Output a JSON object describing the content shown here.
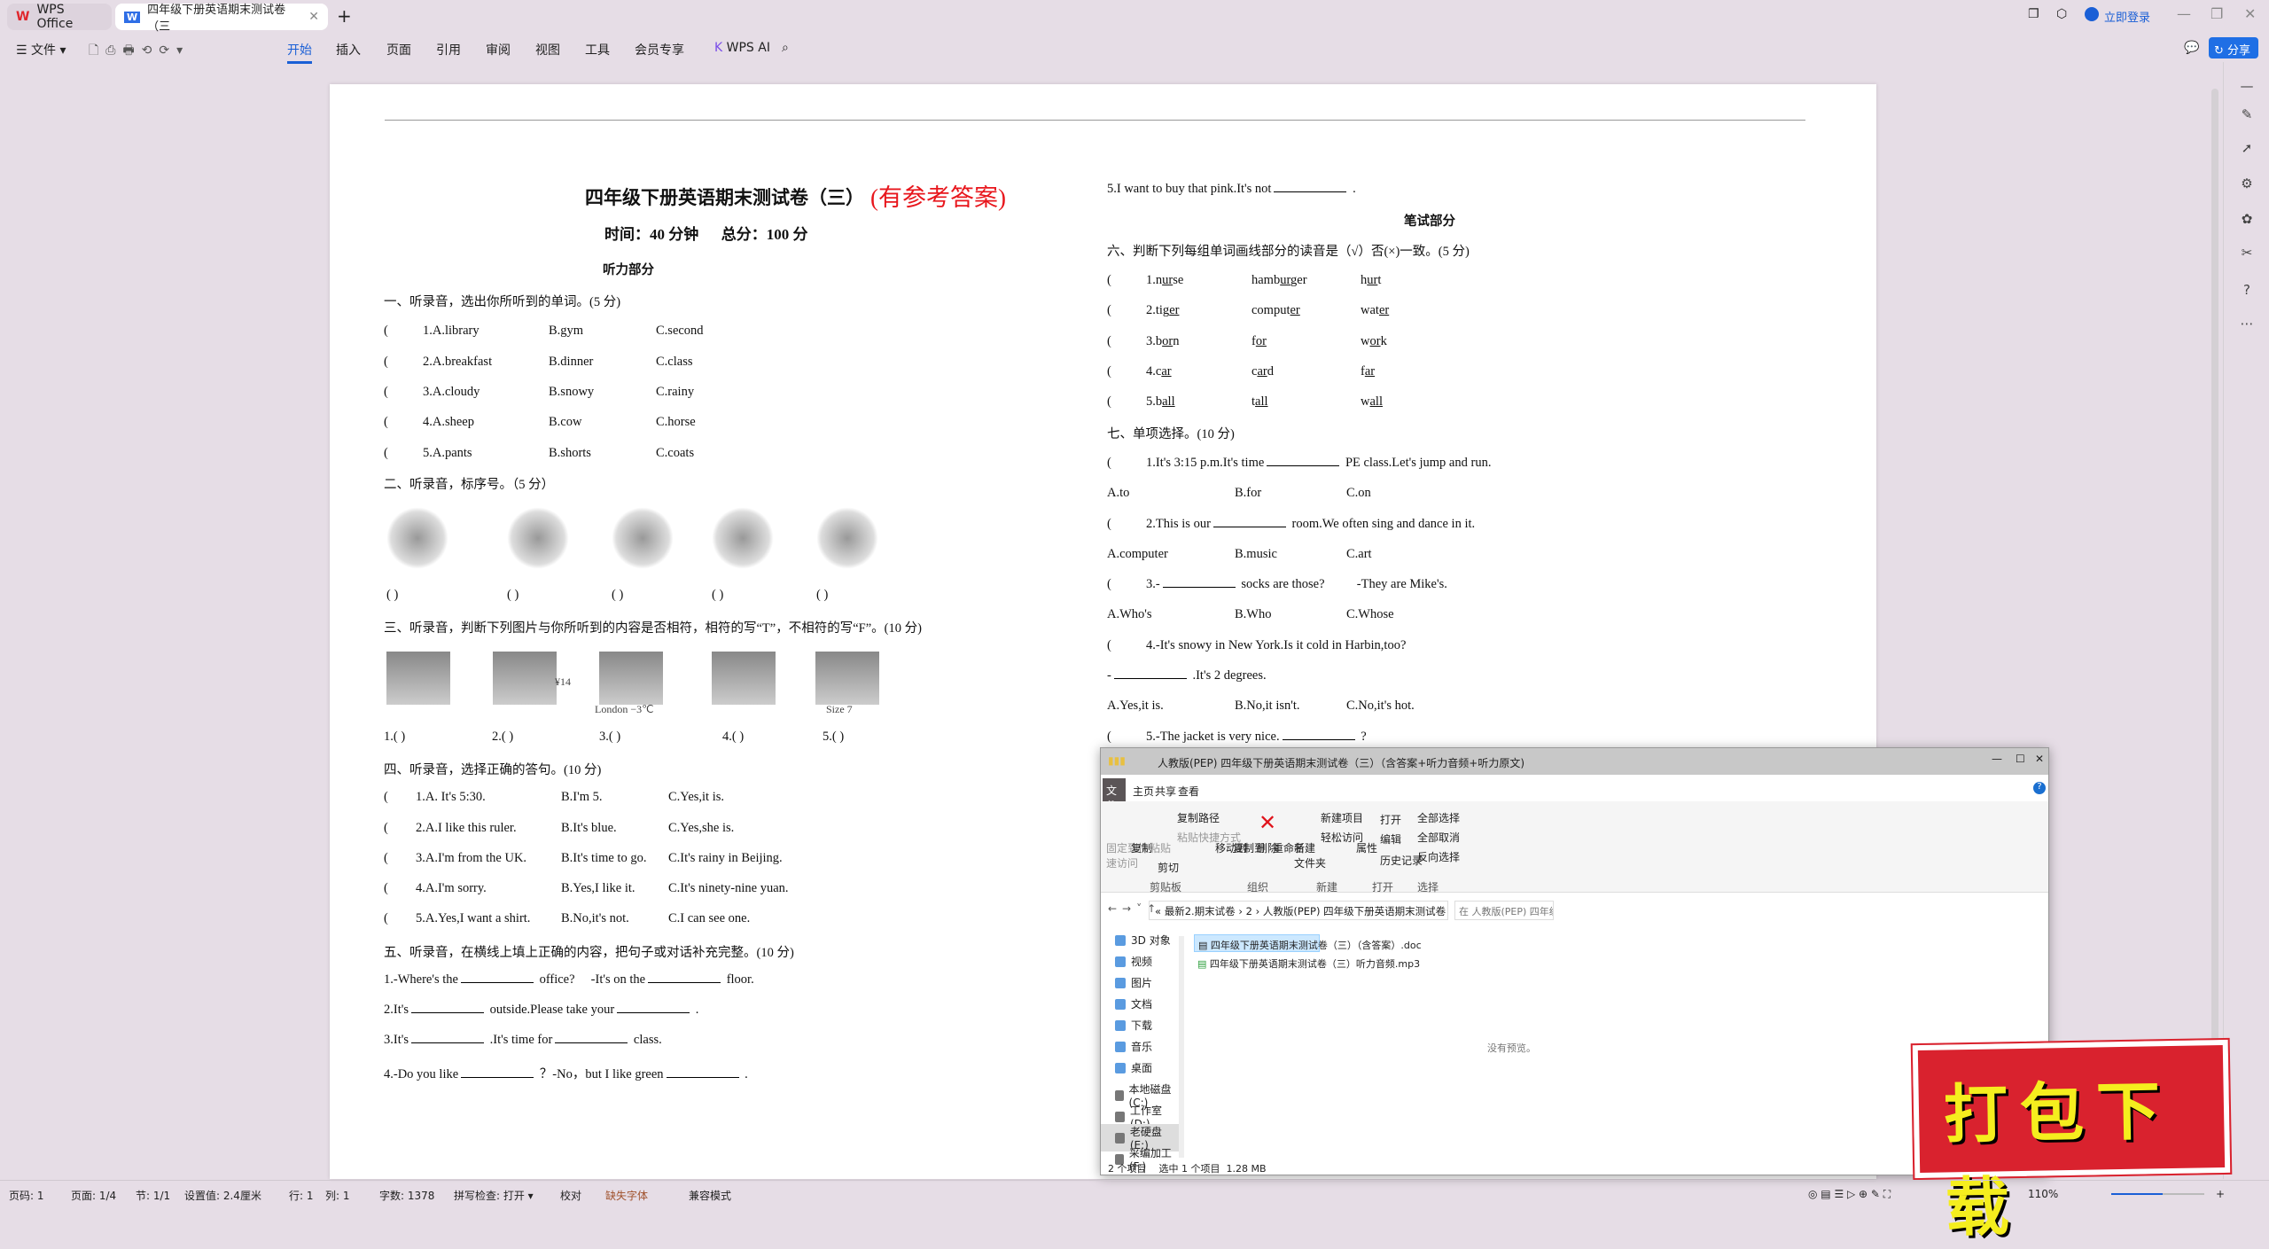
{
  "app": {
    "home_tab": "WPS Office",
    "doc_tab": "四年级下册英语期末测试卷（三",
    "login": "立即登录",
    "share": "分享"
  },
  "toolbar": {
    "file": "文件",
    "menus": [
      "开始",
      "插入",
      "页面",
      "引用",
      "审阅",
      "视图",
      "工具",
      "会员专享"
    ],
    "ai": "WPS AI",
    "accent": "#1a5fd6"
  },
  "doc": {
    "title": "四年级下册英语期末测试卷（三）",
    "title_note": "(有参考答案)",
    "subtitle": "时间：40 分钟      总分：100 分",
    "listening": "听力部分",
    "s1": {
      "heading": "一、听录音，选出你所听到的单词。(5 分)",
      "rows": [
        [
          "1.A.library",
          "B.gym",
          "C.second"
        ],
        [
          "2.A.breakfast",
          "B.dinner",
          "C.class"
        ],
        [
          "3.A.cloudy",
          "B.snowy",
          "C.rainy"
        ],
        [
          "4.A.sheep",
          "B.cow",
          "C.horse"
        ],
        [
          "5.A.pants",
          "B.shorts",
          "C.coats"
        ]
      ]
    },
    "s2": {
      "heading": "二、听录音，标序号。（5 分）",
      "blanks": [
        "(      )",
        "(      )",
        "(      )",
        "(      )",
        "(      )"
      ]
    },
    "s3": {
      "heading": "三、听录音，判断下列图片与你所听到的内容是否相符，相符的写“T”，不相符的写“F”。(10 分)",
      "captions": [
        "",
        "¥14",
        "London −3℃",
        "",
        "Size 7"
      ],
      "labels": [
        "1.(      )",
        "2.(      )",
        "3.(      )",
        "4.(      )",
        "5.(      )"
      ]
    },
    "s4": {
      "heading": "四、听录音，选择正确的答句。(10 分)",
      "rows": [
        [
          "1.A. It's 5:30.",
          "B.I'm 5.",
          "C.Yes,it is."
        ],
        [
          "2.A.I like this ruler.",
          "B.It's blue.",
          "C.Yes,she is."
        ],
        [
          "3.A.I'm from the UK.",
          "B.It's time to go.",
          "C.It's rainy in Beijing."
        ],
        [
          "4.A.I'm sorry.",
          "B.Yes,I like it.",
          "C.It's ninety-nine yuan."
        ],
        [
          "5.A.Yes,I want a shirt.",
          "B.No,it's not.",
          "C.I can see one."
        ]
      ]
    },
    "s5": {
      "heading": "五、听录音，在横线上填上正确的内容，把句子或对话补充完整。(10 分)",
      "rows": [
        [
          "1.-Where's the",
          " office?     -It's on the",
          " floor."
        ],
        [
          "2.It's",
          " outside.Please take your",
          " ."
        ],
        [
          "3.It's",
          " .It's time for",
          " class."
        ],
        [
          "4.-Do you like",
          " ？-No，but I like green",
          " ."
        ],
        [
          "5.I want to buy that pink.It's not",
          " ."
        ]
      ]
    },
    "written": "笔试部分",
    "s6": {
      "heading": "六、判断下列每组单词画线部分的读音是（√）否(×)一致。(5 分)",
      "rows": [
        [
          [
            "1.",
            "nurse",
            "ur"
          ],
          [
            "",
            "hamburger",
            "ur"
          ],
          [
            "",
            "hurt",
            "ur"
          ]
        ],
        [
          [
            "2.",
            "tiger",
            "er"
          ],
          [
            "",
            "computer",
            "er"
          ],
          [
            "",
            "water",
            "er"
          ]
        ],
        [
          [
            "3.",
            "born",
            "or"
          ],
          [
            "",
            "for",
            "or"
          ],
          [
            "",
            "work",
            "or"
          ]
        ],
        [
          [
            "4.",
            "car",
            "ar"
          ],
          [
            "",
            "card",
            "ar"
          ],
          [
            "",
            "far",
            "ar"
          ]
        ],
        [
          [
            "5.",
            "ball",
            "all"
          ],
          [
            "",
            "tall",
            "all"
          ],
          [
            "",
            "wall",
            "all"
          ]
        ]
      ]
    },
    "s7": {
      "heading": "七、单项选择。(10 分)",
      "items": [
        {
          "q": [
            "1.It's 3:15 p.m.It's time",
            " PE class.Let's jump and run."
          ],
          "opts": [
            "A.to",
            "B.for",
            "C.on"
          ]
        },
        {
          "q": [
            "2.This is our",
            " room.We often sing and dance in it."
          ],
          "opts": [
            "A.computer",
            "B.music",
            "C.art"
          ]
        },
        {
          "q": [
            "3.-",
            " socks are those?          -They are Mike's."
          ],
          "opts": [
            "A.Who's",
            "B.Who",
            "C.Whose"
          ]
        },
        {
          "q": [
            "4.-It's snowy in New York.Is it cold in Harbin,too?"
          ],
          "q2": [
            "-",
            " .It's 2 degrees."
          ],
          "opts": [
            "A.Yes,it is.",
            "B.No,it isn't.",
            "C.No,it's hot."
          ]
        },
        {
          "q": [
            "5.-The jacket is very nice.",
            " ?"
          ]
        }
      ]
    }
  },
  "explorer": {
    "title": "人教版(PEP) 四年级下册英语期末测试卷（三）（含答案+听力音频+听力原文)",
    "tabs": [
      "文件",
      "主页",
      "共享",
      "查看"
    ],
    "ribbon": {
      "pin": "固定到快\n速访问",
      "copy": "复制",
      "paste": "粘贴",
      "copy_path": "复制路径",
      "paste_shortcut": "粘贴快捷方式",
      "cut": "剪切",
      "move_to": "移动到",
      "copy_to": "复制到",
      "delete": "删除",
      "rename": "重命名",
      "new_folder": "新建\n文件夹",
      "new_item": "新建项目",
      "easy_access": "轻松访问",
      "properties": "属性",
      "open": "打开",
      "edit": "编辑",
      "history": "历史记录",
      "select_all": "全部选择",
      "select_none": "全部取消",
      "invert": "反向选择"
    },
    "groups": [
      "剪贴板",
      "组织",
      "新建",
      "打开",
      "选择"
    ],
    "path": [
      "最新2.期末试卷",
      "2",
      "人教版(PEP) 四年级下册英语期末测试卷（三）（含答案+听力音频+听力原文)"
    ],
    "search_placeholder": "在 人教版(PEP) 四年级下册英语期...",
    "nav": [
      "3D 对象",
      "视频",
      "图片",
      "文档",
      "下载",
      "音乐",
      "桌面",
      "本地磁盘 (C:)",
      "工作室 (D:)",
      "老硬盘 (E:)",
      "采编加工 (F:)"
    ],
    "files": [
      "四年级下册英语期末测试卷（三）（含答案）.doc",
      "四年级下册英语期末测试卷（三）听力音频.mp3"
    ],
    "no_preview": "没有预览。",
    "status": "2 个项目    选中 1 个项目  1.28 MB"
  },
  "badge": "打包下载",
  "status": {
    "items": [
      "页码: 1",
      "页面: 1/4",
      "节: 1/1",
      "设置值: 2.4厘米",
      "行: 1",
      "列: 1",
      "字数: 1378",
      "拼写检查: 打开 ▾",
      "校对",
      "缺失字体",
      "兼容模式"
    ],
    "zoom": "110%"
  }
}
